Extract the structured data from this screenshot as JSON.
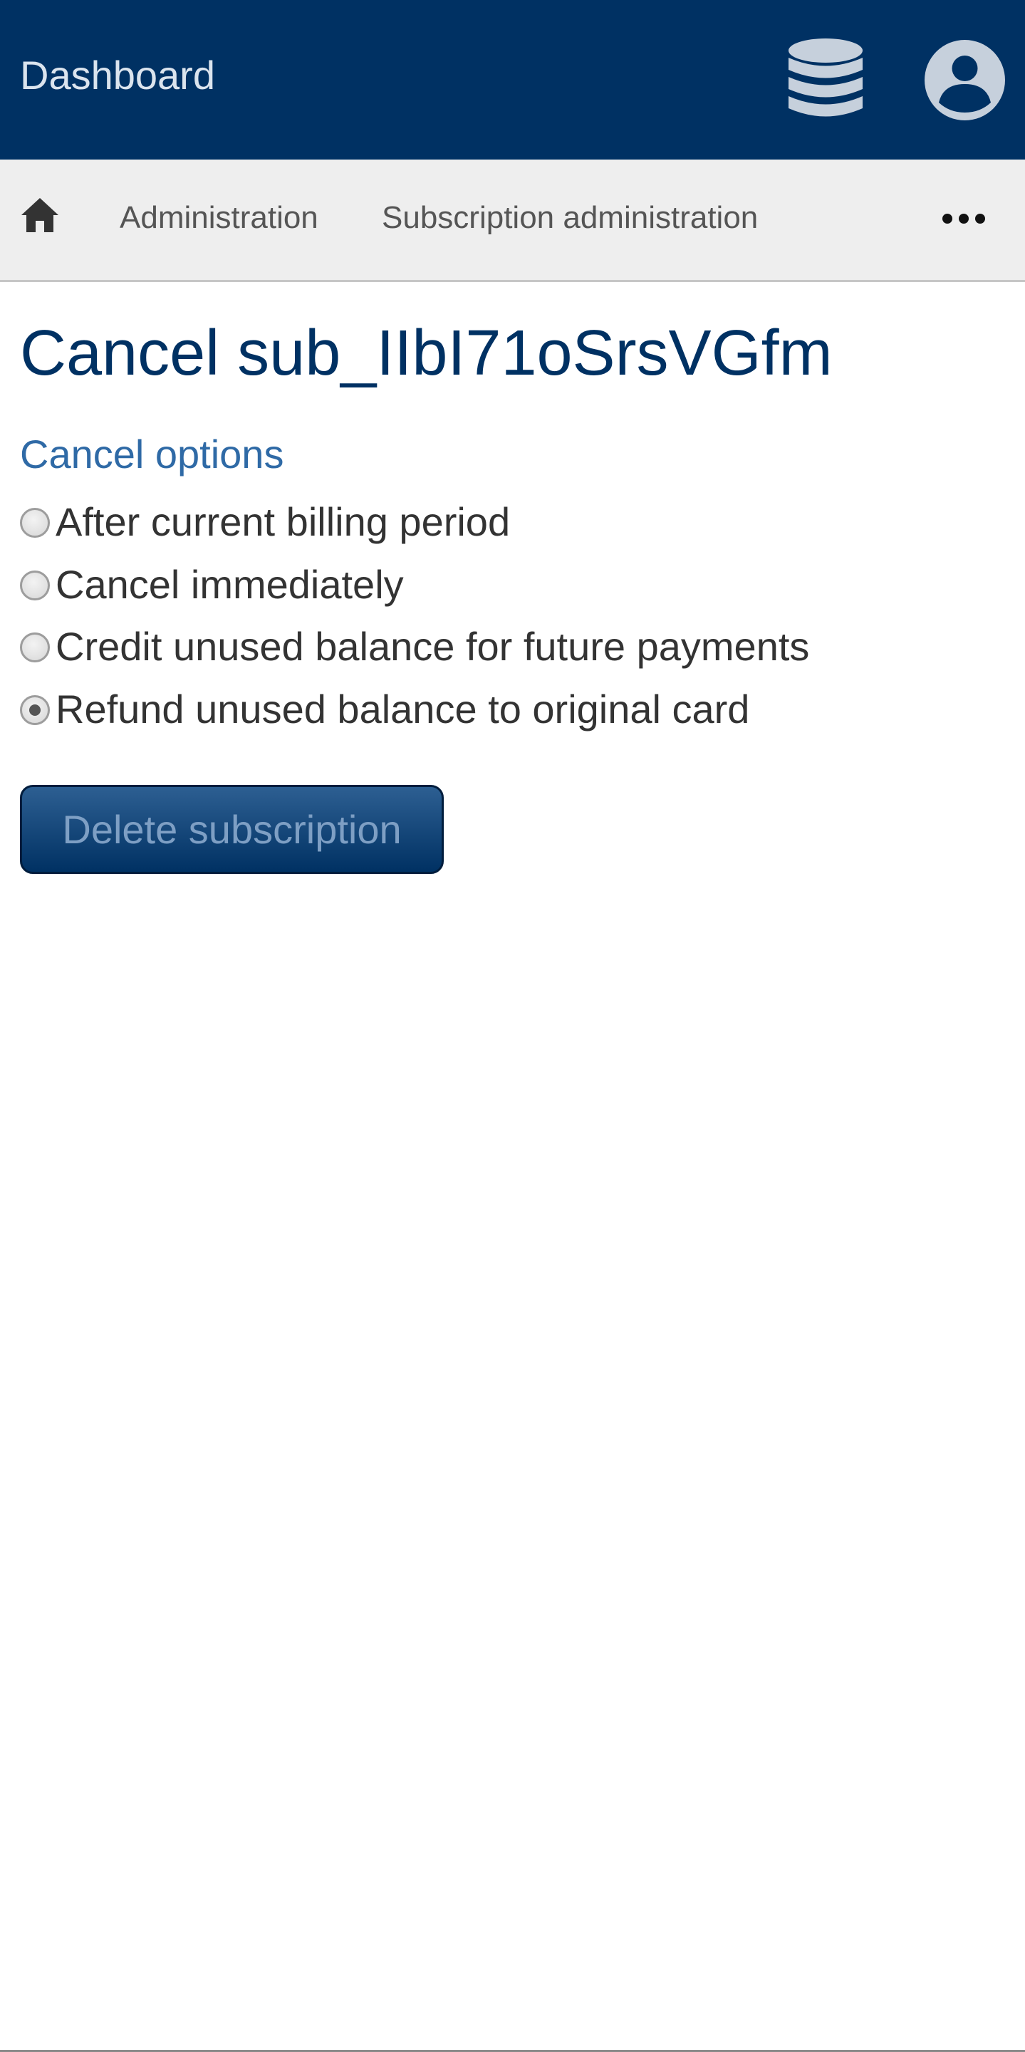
{
  "header": {
    "brand": "Dashboard",
    "brand_color": "#003163",
    "icons": [
      "database-icon",
      "user-account-icon"
    ]
  },
  "breadcrumb": {
    "home_icon": "home-icon",
    "items": [
      {
        "label": "Administration"
      },
      {
        "label": "Subscription administration"
      }
    ],
    "more_icon": "more-horizontal-icon"
  },
  "main": {
    "title": "Cancel sub_IIbI71oSrsVGfm",
    "section_title": "Cancel options",
    "options": [
      {
        "label": "After current billing period",
        "selected": false
      },
      {
        "label": "Cancel immediately",
        "selected": false
      },
      {
        "label": "Credit unused balance for future payments",
        "selected": false
      },
      {
        "label": "Refund unused balance to original card",
        "selected": true
      }
    ],
    "delete_button": "Delete subscription"
  },
  "colors": {
    "accent": "#003163",
    "section_heading": "#2f6aa6",
    "breadcrumb_bg": "#eeeeee"
  }
}
